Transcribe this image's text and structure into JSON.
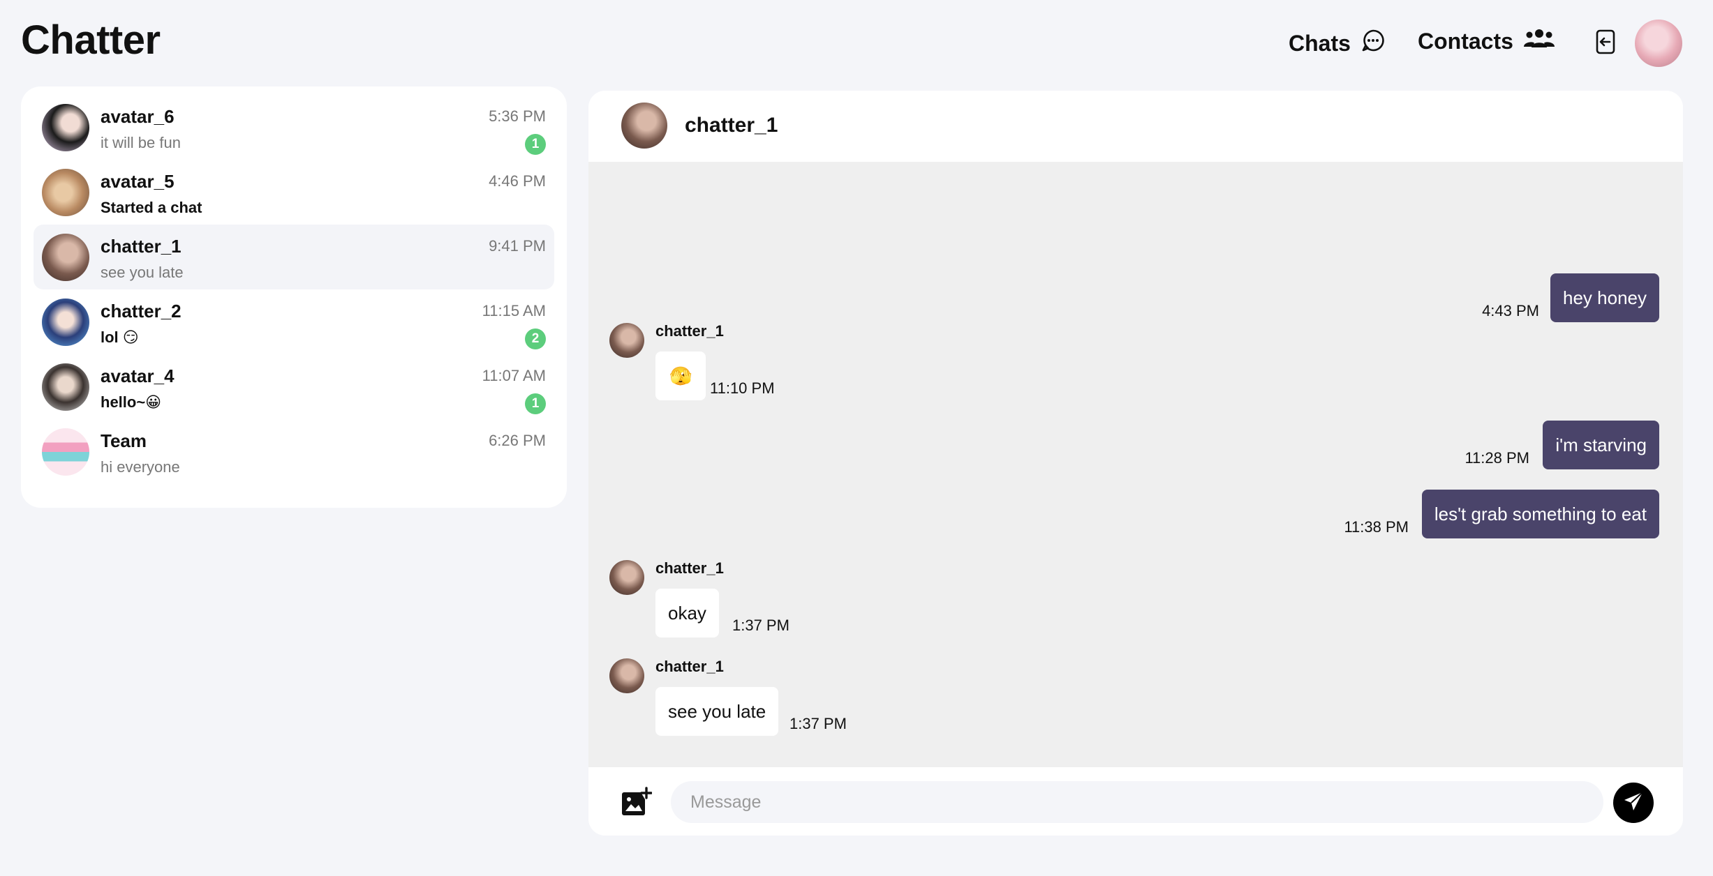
{
  "app": {
    "title": "Chatter"
  },
  "nav": {
    "chats_label": "Chats",
    "contacts_label": "Contacts"
  },
  "chat_list": [
    {
      "name": "avatar_6",
      "preview": "it will be fun",
      "time": "5:36 PM",
      "unread": "1",
      "active": false,
      "preview_bold": false
    },
    {
      "name": "avatar_5",
      "preview": "Started a chat",
      "time": "4:46 PM",
      "unread": "",
      "active": false,
      "preview_bold": true
    },
    {
      "name": "chatter_1",
      "preview": "see you late",
      "time": "9:41 PM",
      "unread": "",
      "active": true,
      "preview_bold": false
    },
    {
      "name": "chatter_2",
      "preview": "lol 😏",
      "time": "11:15 AM",
      "unread": "2",
      "active": false,
      "preview_bold": true
    },
    {
      "name": "avatar_4",
      "preview": "hello~😀",
      "time": "11:07 AM",
      "unread": "1",
      "active": false,
      "preview_bold": true
    },
    {
      "name": "Team",
      "preview": "hi everyone",
      "time": "6:26 PM",
      "unread": "",
      "active": false,
      "preview_bold": false
    }
  ],
  "conversation": {
    "contact_name": "chatter_1",
    "messages": [
      {
        "direction": "out",
        "text": "hey honey",
        "time": "4:43 PM"
      },
      {
        "direction": "in",
        "sender": "chatter_1",
        "text": "🫣",
        "time": "11:10 PM"
      },
      {
        "direction": "out",
        "text": "i'm starving",
        "time": "11:28 PM"
      },
      {
        "direction": "out",
        "text": "les't grab something to eat",
        "time": "11:38 PM"
      },
      {
        "direction": "in",
        "sender": "chatter_1",
        "text": "okay",
        "time": "1:37 PM"
      },
      {
        "direction": "in",
        "sender": "chatter_1",
        "text": "see you late",
        "time": "1:37 PM"
      }
    ]
  },
  "composer": {
    "placeholder": "Message"
  },
  "icons": {
    "chats": "chat-bubble-icon",
    "contacts": "people-icon",
    "logout": "logout-icon",
    "attach": "add-image-icon",
    "send": "send-icon"
  },
  "colors": {
    "accent": "#4a446a",
    "badge": "#5ccd7c",
    "background": "#f4f5f9",
    "messages_bg": "#efefef"
  }
}
